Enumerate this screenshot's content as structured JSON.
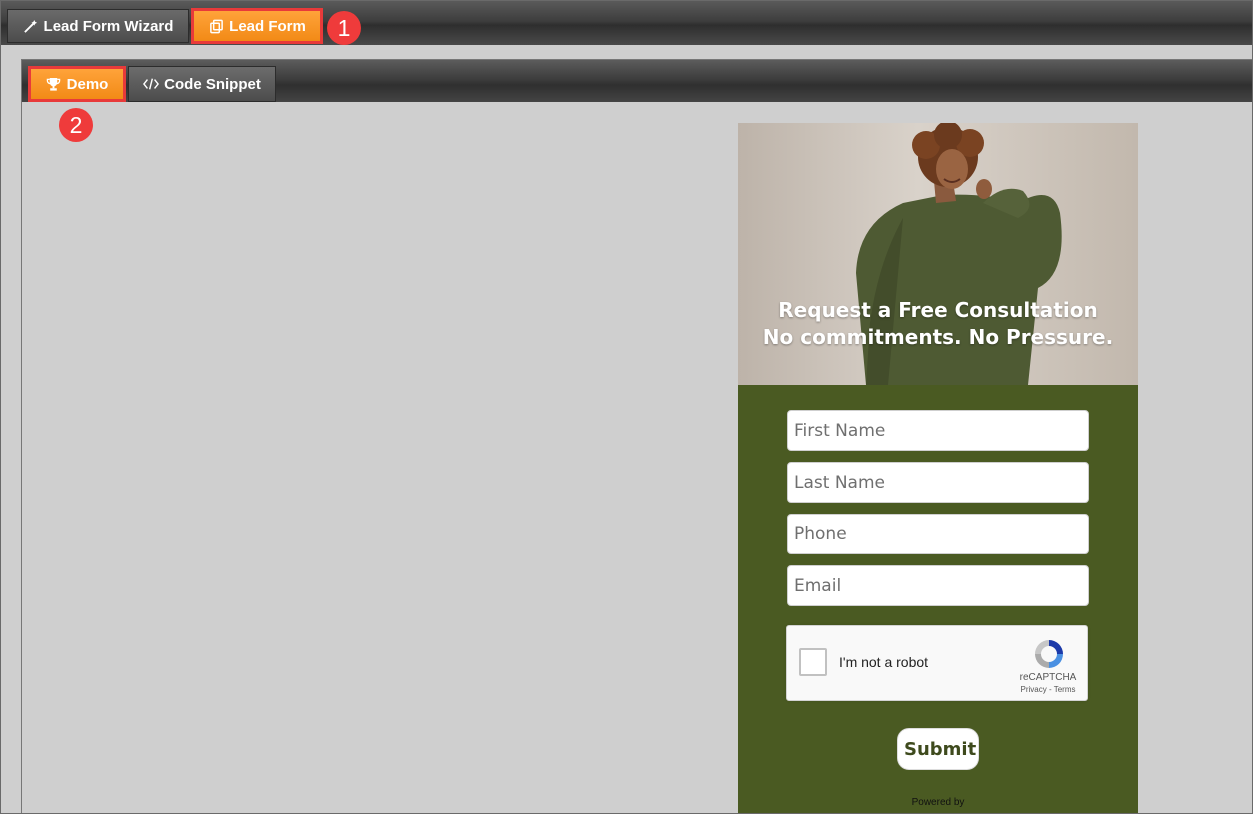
{
  "top_tabs": {
    "wizard_label": "Lead Form Wizard",
    "leadform_label": "Lead Form"
  },
  "sub_tabs": {
    "demo_label": "Demo",
    "code_label": "Code Snippet"
  },
  "callouts": {
    "one": "1",
    "two": "2"
  },
  "form": {
    "headline_line1": "Request a Free Consultation",
    "headline_line2": "No commitments. No Pressure.",
    "first_name_placeholder": "First Name",
    "last_name_placeholder": "Last Name",
    "phone_placeholder": "Phone",
    "email_placeholder": "Email",
    "captcha_label": "I'm not a robot",
    "captcha_brand": "reCAPTCHA",
    "captcha_links": "Privacy - Terms",
    "submit_label": "Submit",
    "powered_by": "Powered by"
  },
  "colors": {
    "accent_orange": "#f7921e",
    "highlight_red": "#e83a3a",
    "form_green": "#4a5a22"
  },
  "icons": {
    "wizard": "magic-wand-icon",
    "leadform": "copy-icon",
    "demo": "trophy-icon",
    "code": "code-icon"
  }
}
